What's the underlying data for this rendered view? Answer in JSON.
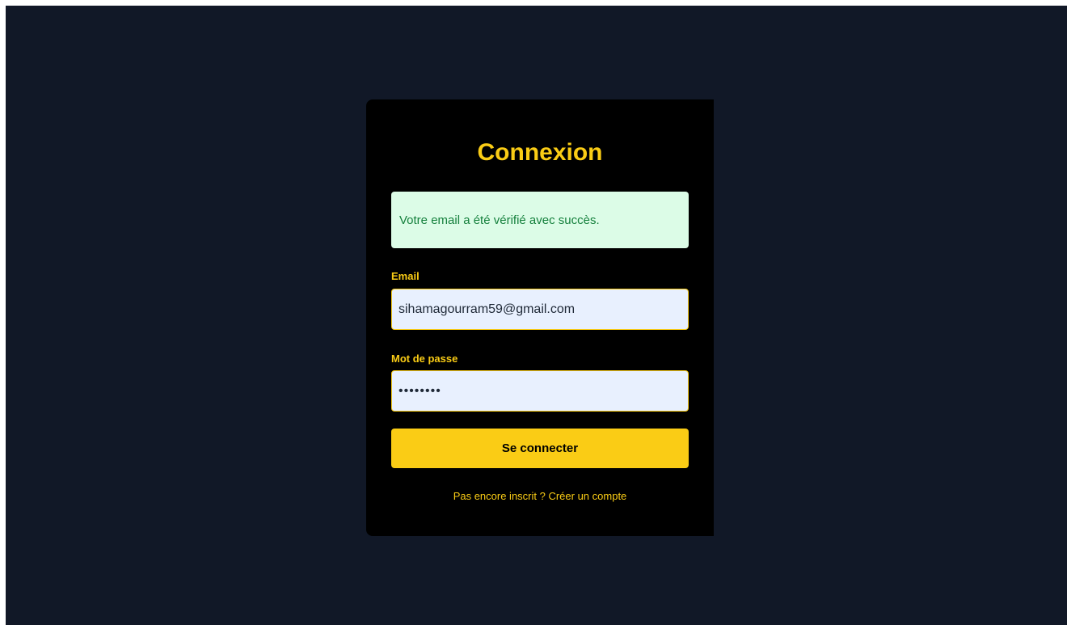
{
  "login": {
    "title": "Connexion",
    "success_message": "Votre email a été vérifié avec succès.",
    "email_label": "Email",
    "email_value": "sihamagourram59@gmail.com",
    "password_label": "Mot de passe",
    "password_value": "••••••••",
    "submit_label": "Se connecter",
    "register_link": "Pas encore inscrit ? Créer un compte"
  },
  "colors": {
    "page_background": "#111827",
    "card_background": "#000000",
    "accent": "#facc15",
    "success_background": "#dcfce7",
    "success_text": "#15803d",
    "input_background": "#e8f0fe"
  }
}
